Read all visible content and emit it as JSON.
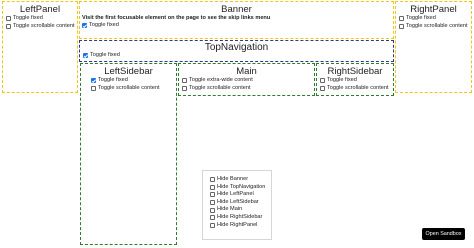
{
  "left_panel": {
    "title": "LeftPanel",
    "options": [
      {
        "label": "Toggle fixed",
        "checked": false
      },
      {
        "label": "Toggle scrollable content",
        "checked": false
      }
    ]
  },
  "banner": {
    "title": "Banner",
    "note": "Visit the first focusable element on the page to see the skip links menu",
    "options": [
      {
        "label": "Toggle fixed",
        "checked": true
      }
    ]
  },
  "right_panel": {
    "title": "RightPanel",
    "options": [
      {
        "label": "Toggle fixed",
        "checked": false
      },
      {
        "label": "Toggle scrollable content",
        "checked": false
      }
    ]
  },
  "top_navigation": {
    "title": "TopNavigation",
    "options": [
      {
        "label": "Toggle fixed",
        "checked": true
      }
    ]
  },
  "left_sidebar": {
    "title": "LeftSidebar",
    "options": [
      {
        "label": "Toggle fixed",
        "checked": true
      },
      {
        "label": "Toggle scrollable content",
        "checked": false
      }
    ]
  },
  "main": {
    "title": "Main",
    "options": [
      {
        "label": "Toggle extra-wide content",
        "checked": false
      },
      {
        "label": "Toggle scrollable content",
        "checked": false
      }
    ]
  },
  "right_sidebar": {
    "title": "RightSidebar",
    "options": [
      {
        "label": "Toggle fixed",
        "checked": false
      },
      {
        "label": "Toggle scrollable content",
        "checked": false
      }
    ]
  },
  "hide_controls": {
    "options": [
      {
        "label": "Hide Banner",
        "checked": false
      },
      {
        "label": "Hide TopNavigation",
        "checked": false
      },
      {
        "label": "Hide LeftPanel",
        "checked": false
      },
      {
        "label": "Hide LeftSidebar",
        "checked": false
      },
      {
        "label": "Hide Main",
        "checked": false
      },
      {
        "label": "Hide RightSidebar",
        "checked": false
      },
      {
        "label": "Hide RightPanel",
        "checked": false
      }
    ]
  },
  "sandbox": {
    "label": "Open Sandbox"
  },
  "colors": {
    "panel_border": "#f0c419",
    "top_nav_border": "#2a3a8c",
    "sidebar_border": "#2f7a2f",
    "checkbox_checked": "#1a73e8"
  }
}
